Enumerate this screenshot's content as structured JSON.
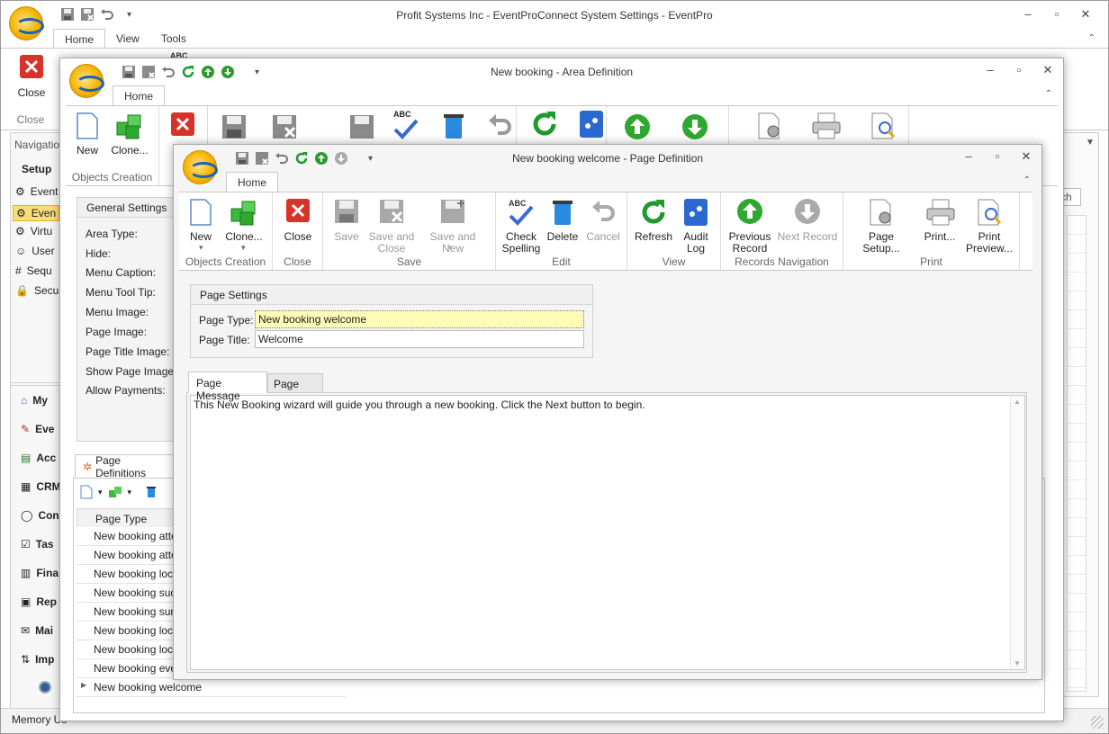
{
  "main": {
    "title": "Profit Systems Inc - EventProConnect System Settings - EventPro",
    "tabs": [
      "Home",
      "View",
      "Tools"
    ],
    "close_label": "Close",
    "close_group": "Close",
    "nav_header": "Navigation",
    "setup_label": "Setup",
    "setup_items": [
      "Event",
      "Even",
      "Virtu",
      "User",
      "Sequ",
      "Secu"
    ],
    "modules": [
      "My",
      "Eve",
      "Acc",
      "CRM",
      "Con",
      "Tas",
      "Fina",
      "Rep",
      "Mai",
      "Imp"
    ],
    "status_text": "Memory Us",
    "search_hint": "rch",
    "abc": "ABC"
  },
  "area": {
    "title": "New booking - Area Definition",
    "tab": "Home",
    "objects_group": "Objects Creation",
    "new_label": "New",
    "clone_label": "Clone...",
    "general_settings": "General Settings",
    "fields": [
      "Area Type:",
      "Hide:",
      "Menu Caption:",
      "Menu Tool Tip:",
      "Menu Image:",
      "Page Image:",
      "Page Title Image:",
      "Show Page Image on",
      "Allow Payments:"
    ],
    "page_defs_tab": "Page Definitions",
    "grid_header": "Page Type",
    "grid_rows": [
      "New booking atten",
      "New booking atten",
      "New booking locati",
      "New booking succe",
      "New booking summ",
      "New booking locati",
      "New booking locati",
      "New booking even",
      "New booking welcome"
    ],
    "abc": "ABC"
  },
  "page": {
    "title": "New booking welcome - Page Definition",
    "tab": "Home",
    "groups": {
      "objects": "Objects Creation",
      "close": "Close",
      "save": "Save",
      "edit": "Edit",
      "view": "View",
      "records": "Records Navigation",
      "print": "Print"
    },
    "buttons": {
      "new": "New",
      "clone": "Clone...",
      "close": "Close",
      "save": "Save",
      "save_close": "Save and Close",
      "save_new": "Save and New",
      "check_spelling": "Check Spelling",
      "delete": "Delete",
      "cancel": "Cancel",
      "refresh": "Refresh",
      "audit_log": "Audit Log",
      "prev_record": "Previous Record",
      "next_record": "Next Record",
      "page_setup": "Page Setup...",
      "print": "Print...",
      "print_preview": "Print Preview..."
    },
    "abc": "ABC",
    "page_settings": "Page Settings",
    "page_type_label": "Page Type:",
    "page_type_value": "New booking welcome",
    "page_title_label": "Page Title:",
    "page_title_value": "Welcome",
    "msg_tabs": [
      "Page Message",
      "Page Help"
    ],
    "message": "This New Booking wizard will guide you through a new booking. Click the Next button to begin."
  }
}
